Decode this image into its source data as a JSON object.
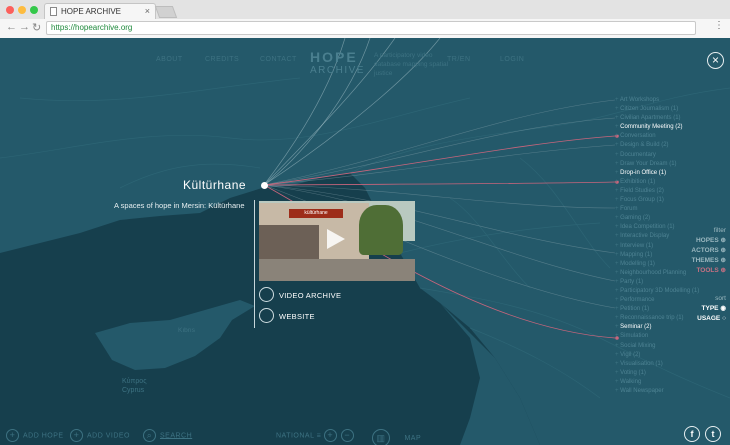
{
  "browser": {
    "tab_title": "HOPE ARCHIVE",
    "url": "https://hopearchive.org",
    "close_glyph": "×",
    "menu_glyph": "⋮",
    "back_glyph": "←",
    "forward_glyph": "→",
    "reload_glyph": "↻"
  },
  "nav": {
    "about": "ABOUT",
    "credits": "CREDITS",
    "contact": "CONTACT",
    "lang": "TR/EN",
    "login": "LOGIN"
  },
  "logo": {
    "line1": "HOPE",
    "line2": "ARCHIVE",
    "tagline": "A participatory video database mapping spatial justice"
  },
  "place": {
    "name": "Kültürhane",
    "description": "A spaces of hope in Mersin: Kültürhane",
    "thumb_sign": "kültürhane",
    "links": [
      "VIDEO ARCHIVE",
      "WEBSITE"
    ]
  },
  "types": [
    {
      "label": "Art Workshops",
      "hl": false
    },
    {
      "label": "Citizen Journalism (1)",
      "hl": false
    },
    {
      "label": "Civilian Apartments (1)",
      "hl": false
    },
    {
      "label": "Community Meeting (2)",
      "hl": true
    },
    {
      "label": "Conversation",
      "hl": false
    },
    {
      "label": "Design & Build (2)",
      "hl": false
    },
    {
      "label": "Documentary",
      "hl": false
    },
    {
      "label": "Draw Your Dream (1)",
      "hl": false
    },
    {
      "label": "Drop-in Office (1)",
      "hl": true
    },
    {
      "label": "Exhibition (1)",
      "hl": false
    },
    {
      "label": "Field Studies (2)",
      "hl": false
    },
    {
      "label": "Focus Group (1)",
      "hl": false
    },
    {
      "label": "Forum",
      "hl": false
    },
    {
      "label": "Gaming (2)",
      "hl": false
    },
    {
      "label": "Idea Competition (1)",
      "hl": false
    },
    {
      "label": "Interactive Display",
      "hl": false
    },
    {
      "label": "Interview (1)",
      "hl": false
    },
    {
      "label": "Mapping (1)",
      "hl": false
    },
    {
      "label": "Modelling (1)",
      "hl": false
    },
    {
      "label": "Neighbourhood Planning",
      "hl": false
    },
    {
      "label": "Party (1)",
      "hl": false
    },
    {
      "label": "Participatory 3D Modelling (1)",
      "hl": false
    },
    {
      "label": "Performance",
      "hl": false
    },
    {
      "label": "Petition (1)",
      "hl": false
    },
    {
      "label": "Reconnaissance trip (1)",
      "hl": false
    },
    {
      "label": "Seminar (2)",
      "hl": true
    },
    {
      "label": "Simulation",
      "hl": false
    },
    {
      "label": "Social Mixing",
      "hl": false
    },
    {
      "label": "Vigil (2)",
      "hl": false
    },
    {
      "label": "Visualisation (1)",
      "hl": false
    },
    {
      "label": "Voting (1)",
      "hl": false
    },
    {
      "label": "Walking",
      "hl": false
    },
    {
      "label": "Wall Newspaper",
      "hl": false
    }
  ],
  "filter": {
    "heading": "filter",
    "items": [
      "HOPES",
      "ACTORS",
      "THEMES",
      "TOOLS"
    ]
  },
  "sort": {
    "heading": "sort",
    "items": [
      "TYPE",
      "USAGE"
    ]
  },
  "map_labels": {
    "cyprus_tr": "Kıbrıs",
    "cyprus_gr": "Κύπρος",
    "cyprus_en": "Cyprus"
  },
  "bottom": {
    "add_hope": "ADD HOPE",
    "add_video": "ADD VIDEO",
    "search": "SEARCH",
    "national": "NATIONAL",
    "map": "MAP",
    "plus": "+",
    "minus": "−",
    "facebook": "f",
    "twitter": "t"
  },
  "colors": {
    "map_bg": "#1d5263",
    "land": "#24596a",
    "sea": "#163f4d",
    "highlight_line": "#c9657c"
  }
}
